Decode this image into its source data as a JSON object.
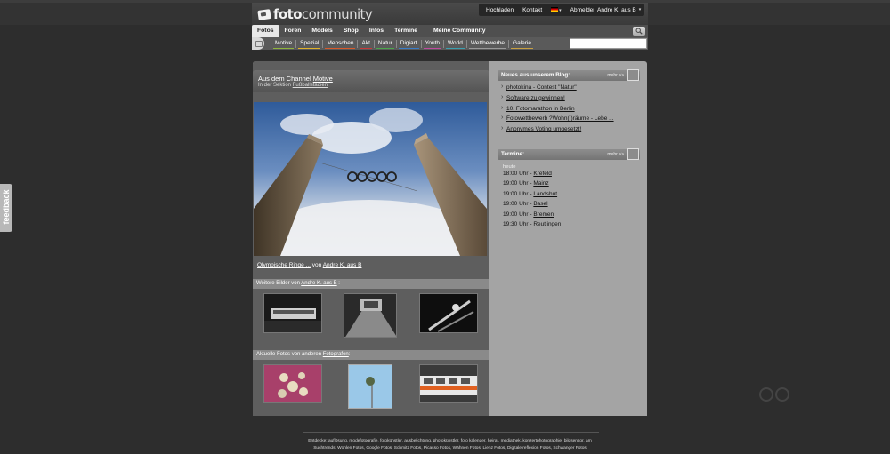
{
  "brand": {
    "name_bold": "foto",
    "name_light": "community"
  },
  "topnav": {
    "upload": "Hochladen",
    "contact": "Kontakt",
    "language_flag": "de",
    "logout": "Abmelden",
    "user": "Andre K. aus B"
  },
  "mainnav": {
    "tabs": [
      "Fotos",
      "Foren",
      "Models",
      "Shop",
      "Infos",
      "Termine"
    ],
    "active": "Fotos",
    "meine": "Meine Community"
  },
  "subnav": {
    "items": [
      {
        "label": "Motive",
        "color": "#8fb43c"
      },
      {
        "label": "Spezial",
        "color": "#e0b22a"
      },
      {
        "label": "Menschen",
        "color": "#d95a2a"
      },
      {
        "label": "Akt",
        "color": "#c93a3a"
      },
      {
        "label": "Natur",
        "color": "#4aa84a"
      },
      {
        "label": "Digiart",
        "color": "#3a7dc8"
      },
      {
        "label": "Youth",
        "color": "#c04aa0"
      },
      {
        "label": "World",
        "color": "#3aa0b0"
      },
      {
        "label": "Wettbewerbe",
        "color": "#9a9a9a"
      },
      {
        "label": "Galerie",
        "color": "#c8a040"
      }
    ],
    "search_value": ""
  },
  "channel": {
    "prefix": "Aus dem Channel",
    "name": "Motive",
    "sub_prefix": "In der Sektion",
    "section": "Fußballstadien"
  },
  "hero": {
    "title": "Olympische Ringe ...",
    "by": "von",
    "author": "Andre K. aus B"
  },
  "more_by": {
    "prefix": "Weitere Bilder von",
    "author": "Andre K. aus B",
    "suffix": ":"
  },
  "recent": {
    "prefix": "Aktuelle Fotos",
    "mid": "von anderen",
    "link": "Fotografen",
    "suffix": ":"
  },
  "blog": {
    "title": "Neues aus unserem Blog:",
    "more": "mehr >>",
    "items": [
      "photokina - Contest \"Natur\"",
      "Software zu gewinnen!",
      "10. Fotomarathon in Berlin",
      "Fotowettbewerb ?Wohn(!)räume - Lebe ...",
      "Anonymes Voting umgesetzt!"
    ]
  },
  "termine": {
    "title": "Termine:",
    "more": "mehr >>",
    "today": "heute",
    "events": [
      {
        "time": "18:00 Uhr",
        "city": "Krefeld"
      },
      {
        "time": "19:00 Uhr",
        "city": "Mainz"
      },
      {
        "time": "19:00 Uhr",
        "city": "Landshut"
      },
      {
        "time": "19:00 Uhr",
        "city": "Basel"
      },
      {
        "time": "19:00 Uhr",
        "city": "Bremen"
      },
      {
        "time": "19:30 Uhr",
        "city": "Reutlingen"
      }
    ]
  },
  "feedback": "feedback",
  "footer": {
    "line1": "Entdecke: auflösung, modefotografie, fotokünstler, ausbelichtung, photokünstler, foto kalender, heirat, mediathek, konzertphotographie, bildsensor, am",
    "line2": "Suchtrends: Wohlen Fotos, Google Fotos, Schmitz Fotos, Picasso Fotos, Wähnen Fotos, Lienz Fotos, Digitale reflexion Fotos, Schwanger Fotos"
  }
}
